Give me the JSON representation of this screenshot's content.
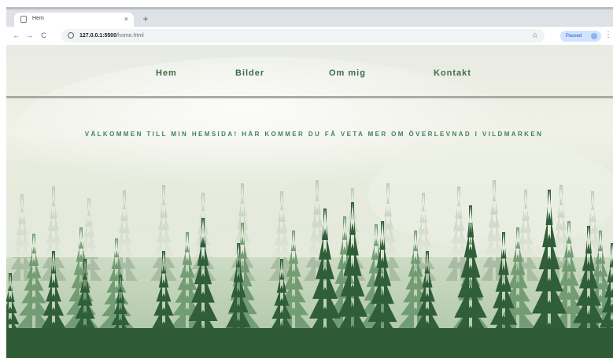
{
  "browser": {
    "tab_title": "Hem",
    "tab_close": "×",
    "new_tab": "+",
    "back": "←",
    "forward": "→",
    "reload": "C",
    "url_host": "127.0.0.1:5500",
    "url_path": "/home.html",
    "bookmark": "☆",
    "profile_status": "Paused",
    "menu": "⋮"
  },
  "nav": {
    "items": [
      {
        "label": "Hem"
      },
      {
        "label": "Bilder"
      },
      {
        "label": "Om mig"
      },
      {
        "label": "Kontakt"
      }
    ]
  },
  "main": {
    "welcome_text": "VÄLKOMMEN TILL MIN HEMSIDA! HÄR KOMMER DU FÅ VETA MER OM ÖVERLEVNAD I VILDMARKEN"
  },
  "colors": {
    "nav_text": "#3f6b48",
    "welcome_text": "#3d7f63",
    "forest_dark": "#2f5e39",
    "fog": "#e8eadf"
  }
}
